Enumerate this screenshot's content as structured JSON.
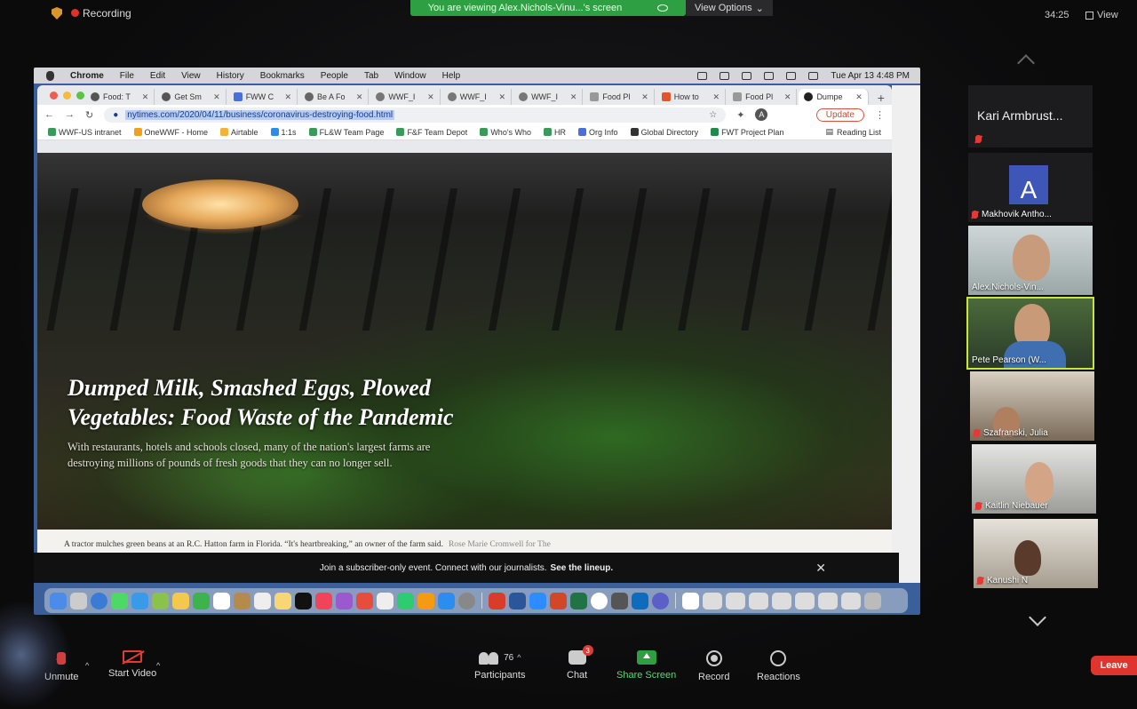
{
  "zoom": {
    "recording_label": "Recording",
    "viewing_banner": "You are viewing Alex.Nichols-Vinu...'s screen",
    "view_options_label": "View Options",
    "clock": "34:25",
    "view_label": "View",
    "leave_label": "Leave",
    "controls": {
      "unmute": "Unmute",
      "start_video": "Start Video",
      "participants": "Participants",
      "participants_count": "76",
      "chat": "Chat",
      "chat_badge": "3",
      "share_screen": "Share Screen",
      "record": "Record",
      "reactions": "Reactions"
    },
    "participants": [
      {
        "name": "Kari Armbrust...",
        "muted": true
      },
      {
        "name": "Makhovik Antho...",
        "initial": "A",
        "muted": true
      },
      {
        "name": "Alex.Nichols-Vin...",
        "muted": false
      },
      {
        "name": "Pete Pearson (W...",
        "muted": false,
        "active": true
      },
      {
        "name": "Szafranski, Julia",
        "muted": true
      },
      {
        "name": "Kaitlin Niebauer",
        "muted": true
      },
      {
        "name": "Kanushi N",
        "muted": true
      }
    ],
    "colors": {
      "accent_green": "#2ea043",
      "leave_red": "#e0352f",
      "active_outline": "#c8e63c"
    }
  },
  "mac": {
    "menubar": [
      "Chrome",
      "File",
      "Edit",
      "View",
      "History",
      "Bookmarks",
      "People",
      "Tab",
      "Window",
      "Help"
    ],
    "datetime": "Tue Apr 13  4:48 PM"
  },
  "browser": {
    "tabs": [
      {
        "label": "Food: T"
      },
      {
        "label": "Get Sm"
      },
      {
        "label": "FWW C"
      },
      {
        "label": "Be A Fo"
      },
      {
        "label": "WWF_I"
      },
      {
        "label": "WWF_I"
      },
      {
        "label": "WWF_I"
      },
      {
        "label": "Food Pl"
      },
      {
        "label": "How to"
      },
      {
        "label": "Food Pl"
      },
      {
        "label": "Dumpe",
        "active": true
      }
    ],
    "url": "nytimes.com/2020/04/11/business/coronavirus-destroying-food.html",
    "update_label": "Update",
    "profile_initial": "A",
    "bookmarks": [
      "WWF-US intranet",
      "OneWWF - Home",
      "Airtable",
      "1:1s",
      "FL&W Team Page",
      "F&F Team Depot",
      "Who's Who",
      "HR",
      "Org Info",
      "Global Directory",
      "FWT Project Plan"
    ],
    "reading_list": "Reading List"
  },
  "article": {
    "headline": "Dumped Milk, Smashed Eggs, Plowed Vegetables: Food Waste of the Pandemic",
    "dek": "With restaurants, hotels and schools closed, many of the nation's largest farms are destroying millions of pounds of fresh goods that they can no longer sell.",
    "caption": "A tractor mulches green beans at an R.C. Hatton farm in Florida. “It's heartbreaking,” an owner of the farm said.",
    "credit": "Rose Marie Cromwell for The",
    "subscriber_banner": "Join a subscriber-only event. Connect with our journalists.",
    "subscriber_link": "See the lineup."
  }
}
